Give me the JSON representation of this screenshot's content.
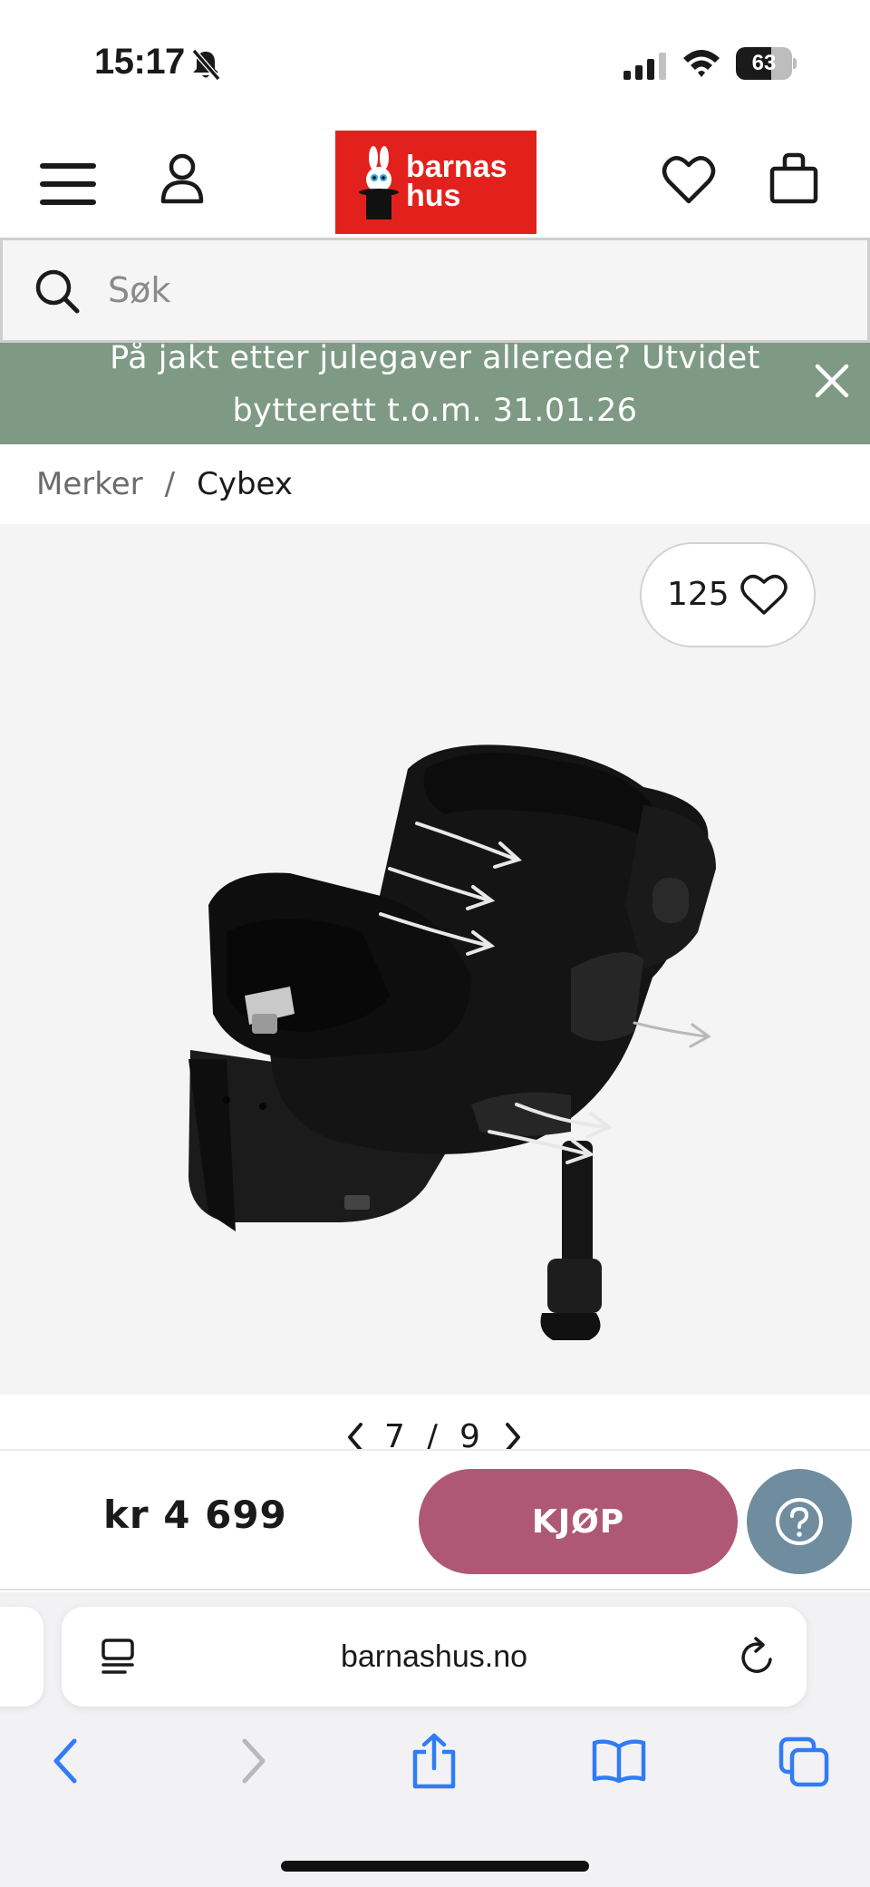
{
  "status_bar": {
    "time": "15:17",
    "battery": "63",
    "battery_level": 0.63
  },
  "header": {
    "logo": {
      "line1": "barnas",
      "line2": "hus"
    },
    "icons": [
      "menu-icon",
      "account-icon",
      "wishlist-icon",
      "cart-icon"
    ]
  },
  "search": {
    "placeholder": "Søk"
  },
  "promo_banner": {
    "text": "På jakt etter julegaver allerede? Utvidet bytterett t.o.m. 31.01.26"
  },
  "breadcrumb": {
    "items": [
      {
        "label": "Merker"
      },
      {
        "label": "Cybex"
      }
    ],
    "separator": "/"
  },
  "gallery": {
    "likes": "125",
    "current": "7",
    "total": "9",
    "pager_separator": "/"
  },
  "buy_bar": {
    "price": "kr 4 699",
    "buy_label": "KJØP"
  },
  "browser": {
    "url": "barnashus.no"
  },
  "colors": {
    "logo_red": "#e2211c",
    "banner_green": "#7e9a84",
    "buy_pink": "#ae5876",
    "help_blue": "#6f8d9e",
    "ios_blue": "#2f7cf6"
  }
}
